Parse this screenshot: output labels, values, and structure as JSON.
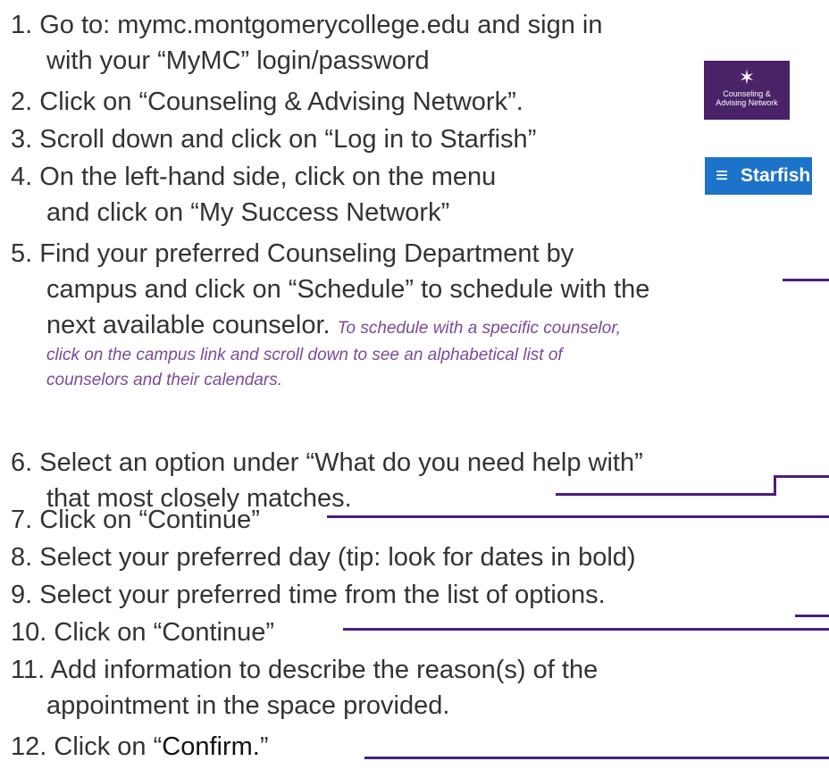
{
  "steps": [
    {
      "num": "1.",
      "text": "Go to:  mymc.montgomerycollege.edu and sign in",
      "cont": "with your “MyMC” login/password"
    },
    {
      "num": "2.",
      "text": "Click on “Counseling & Advising Network”."
    },
    {
      "num": "3.",
      "text": "Scroll down and click on “Log in to Starfish”"
    },
    {
      "num": "4.",
      "text": "On the left-hand side, click on the menu",
      "cont": "and click on “My Success Network”"
    },
    {
      "num": "5.",
      "text": "Find your preferred Counseling Department by",
      "cont": "campus and click on “Schedule” to schedule with the",
      "cont2": "next available counselor.",
      "note_inline": "To schedule with a specific counselor,",
      "note": "click on the campus link and scroll down to see an alphabetical list of",
      "note2": "counselors and their calendars."
    },
    {
      "num": "6.",
      "text": "Select an option under “What do you need help with”",
      "cont": "that most closely matches."
    },
    {
      "num": "7.",
      "text": "Click on “Continue”"
    },
    {
      "num": "8.",
      "text": "Select your preferred day (tip:  look for dates in bold)"
    },
    {
      "num": "9.",
      "text": "Select your preferred time from the list of options."
    },
    {
      "num": "10.",
      "text": "Click on “Continue”"
    },
    {
      "num": "11.",
      "text": "Add information to describe the reason(s) of the",
      "cont": "appointment in the space provided."
    },
    {
      "num": "12.",
      "text_a": "Click on “",
      "text_b": "Confirm.",
      "text_c": "”"
    }
  ],
  "icons": {
    "counseling": {
      "glyph": "✶",
      "label_1": "Counseling &",
      "label_2": "Advising Network"
    },
    "starfish": {
      "glyph": "≡",
      "label": "Starfish"
    }
  },
  "colors": {
    "accent_line": "#4a1e7c",
    "note_text": "#7a4b9a",
    "icon_bg": "#4a2268",
    "starfish_bg": "#1c73c9"
  }
}
